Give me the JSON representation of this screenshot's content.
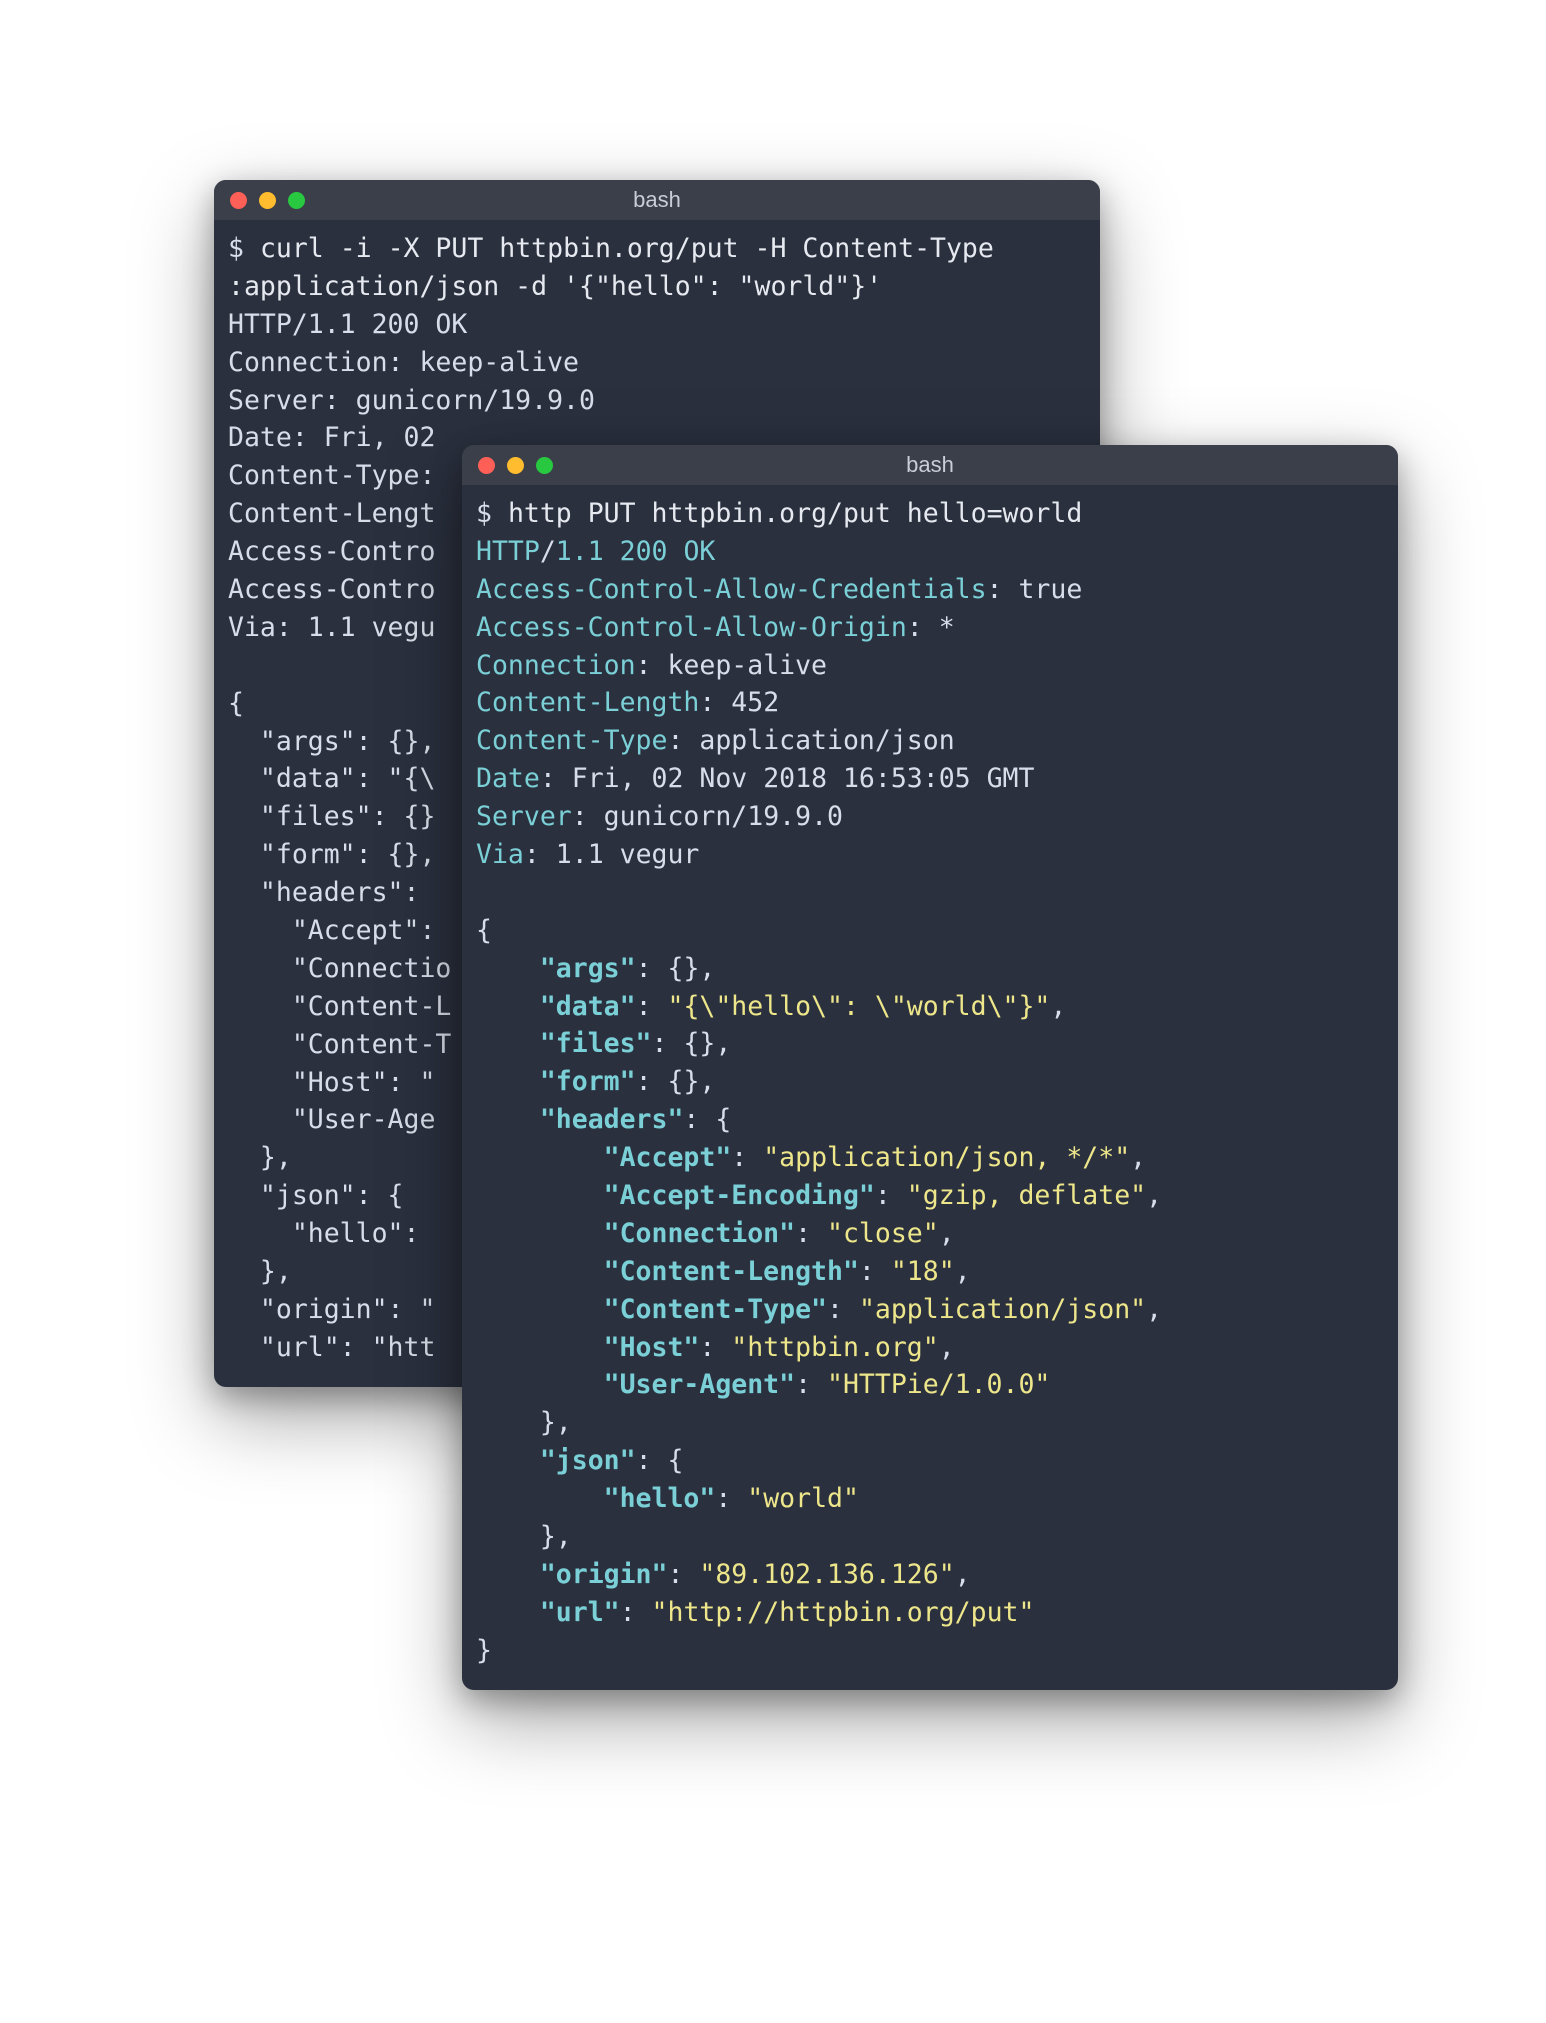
{
  "window1": {
    "title": "bash",
    "prompt": "$",
    "command": "curl -i -X PUT httpbin.org/put -H Content-Type",
    "continuation": ":application/json -d '{\"hello\": \"world\"}'",
    "status_line": "HTTP/1.1 200 OK",
    "headers": {
      "Connection": "keep-alive",
      "Server": "gunicorn/19.9.0",
      "Date": "Fri, 02",
      "Content-Type_label": "Content-Type:",
      "Content-Length_label": "Content-Length",
      "Access-Control1": "Access-Control",
      "Access-Control2": "Access-Control",
      "Via": "1.1 vegu"
    },
    "body_lines": [
      "{",
      "  \"args\": {},",
      "  \"data\": \"{\\",
      "  \"files\": {}",
      "  \"form\": {},",
      "  \"headers\":",
      "    \"Accept\":",
      "    \"Connectio",
      "    \"Content-L",
      "    \"Content-T",
      "    \"Host\": \"",
      "    \"User-Age",
      "  },",
      "  \"json\": {",
      "    \"hello\":",
      "  },",
      "  \"origin\": \"",
      "  \"url\": \"htt"
    ]
  },
  "window2": {
    "title": "bash",
    "prompt": "$",
    "command": "http PUT httpbin.org/put hello=world",
    "status": {
      "proto": "HTTP",
      "rest": "/",
      "ver": "1.1 ",
      "code": "200 ",
      "ok": "OK"
    },
    "headers": [
      [
        "Access-Control-Allow-Credentials",
        "true"
      ],
      [
        "Access-Control-Allow-Origin",
        "*"
      ],
      [
        "Connection",
        "keep-alive"
      ],
      [
        "Content-Length",
        "452"
      ],
      [
        "Content-Type",
        "application/json"
      ],
      [
        "Date",
        "Fri, 02 Nov 2018 16:53:05 GMT"
      ],
      [
        "Server",
        "gunicorn/19.9.0"
      ],
      [
        "Via",
        "1.1 vegur"
      ]
    ],
    "json_body": {
      "args": "{}",
      "data": "\"{\\\"hello\\\": \\\"world\\\"}\"",
      "files": "{}",
      "form": "{}",
      "headers": {
        "Accept": "\"application/json, */*\"",
        "Accept-Encoding": "\"gzip, deflate\"",
        "Connection": "\"close\"",
        "Content-Length": "\"18\"",
        "Content-Type": "\"application/json\"",
        "Host": "\"httpbin.org\"",
        "User-Agent": "\"HTTPie/1.0.0\""
      },
      "json_hello": "\"world\"",
      "origin": "\"89.102.136.126\"",
      "url": "\"http://httpbin.org/put\""
    }
  }
}
